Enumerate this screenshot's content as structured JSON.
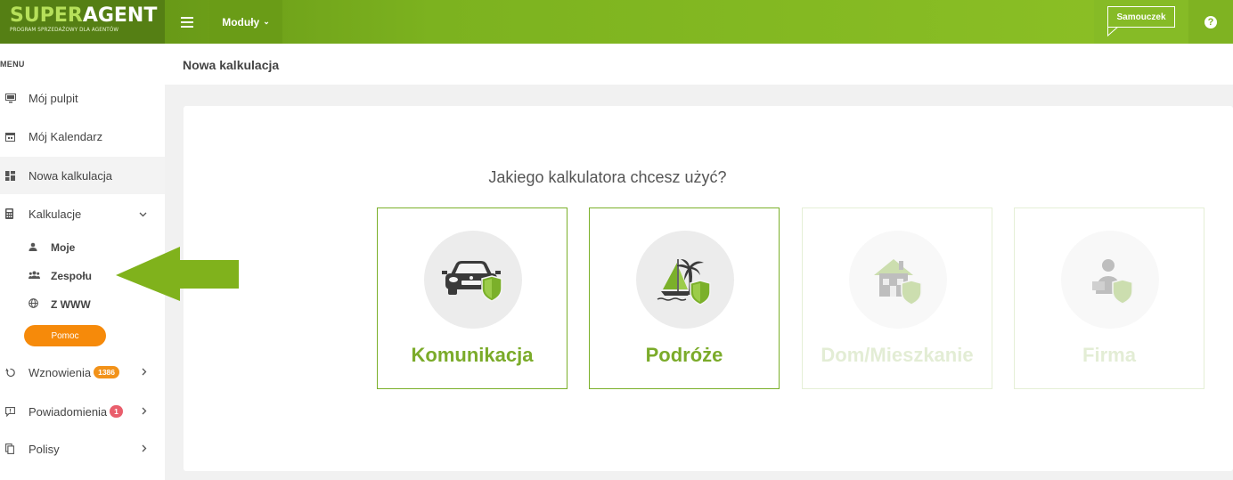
{
  "brand": {
    "name_part1": "SUPER",
    "name_part2": "AGENT",
    "tagline": "PROGRAM SPRZEDAŻOWY DLA AGENTÓW"
  },
  "topbar": {
    "modules_label": "Moduły",
    "tutorial_label": "Samouczek",
    "help_label": "?"
  },
  "sidebar": {
    "menu_title": "MENU",
    "items": [
      {
        "label": "Mój pulpit",
        "icon": "monitor-icon"
      },
      {
        "label": "Mój Kalendarz",
        "icon": "calendar-icon"
      },
      {
        "label": "Nowa kalkulacja",
        "icon": "grid-icon"
      },
      {
        "label": "Kalkulacje",
        "icon": "calculator-icon"
      }
    ],
    "sub_items": [
      {
        "label": "Moje",
        "icon": "user-icon"
      },
      {
        "label": "Zespołu",
        "icon": "team-icon"
      },
      {
        "label": "Z WWW",
        "icon": "globe-icon"
      }
    ],
    "help_button": "Pomoc",
    "lower_items": [
      {
        "label": "Wznowienia",
        "badge": "1386",
        "icon": "refresh-icon"
      },
      {
        "label": "Powiadomienia",
        "badge": "1",
        "icon": "message-icon"
      },
      {
        "label": "Polisy",
        "icon": "copy-icon"
      }
    ]
  },
  "page": {
    "title": "Nowa kalkulacja",
    "question": "Jakiego kalkulatora chcesz użyć?",
    "tiles": [
      {
        "label": "Komunikacja",
        "icon": "car-icon",
        "enabled": true
      },
      {
        "label": "Podróże",
        "icon": "travel-icon",
        "enabled": true
      },
      {
        "label": "Dom/Mieszkanie",
        "icon": "house-icon",
        "enabled": false
      },
      {
        "label": "Firma",
        "icon": "business-icon",
        "enabled": false
      }
    ]
  },
  "colors": {
    "brand_green": "#7bb02a",
    "orange": "#f68a0a",
    "badge_red": "#e95e6c"
  }
}
